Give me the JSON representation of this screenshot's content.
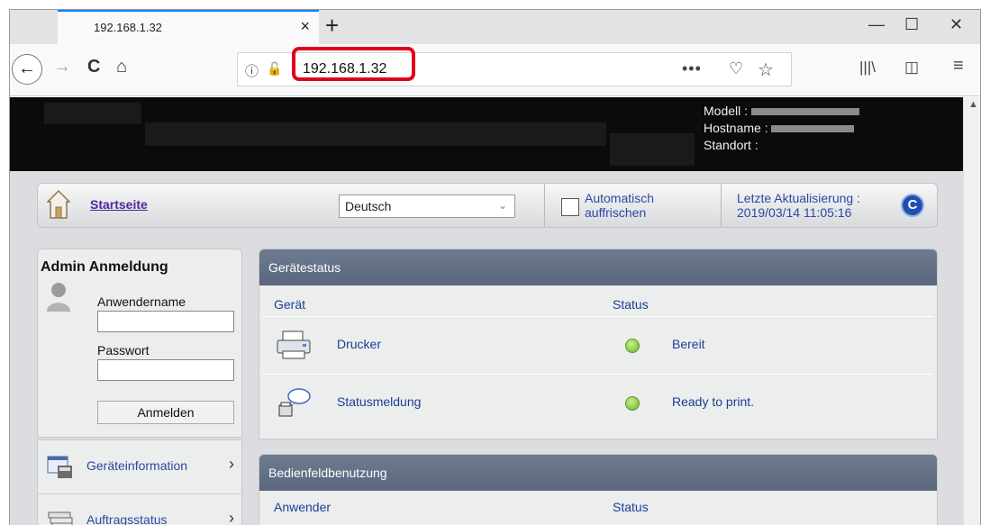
{
  "browser": {
    "tab_title": "192.168.1.32",
    "tab_close": "×",
    "new_tab": "+",
    "url": "192.168.1.32",
    "min": "—",
    "max": "☐",
    "close": "✕",
    "accent": "#0a84ff",
    "highlight_color": "#e0001a"
  },
  "header": {
    "model_label": "Modell :",
    "hostname_label": "Hostname :",
    "location_label": "Standort :"
  },
  "topbar": {
    "home_link": "Startseite",
    "language": "Deutsch",
    "auto_refresh_line1": "Automatisch",
    "auto_refresh_line2": "auffrischen",
    "last_update_label": "Letzte Aktualisierung :",
    "last_update_value": "2019/03/14 11:05:16",
    "refresh_glyph": "C"
  },
  "login": {
    "title": "Admin Anmeldung",
    "username_label": "Anwendername",
    "password_label": "Passwort",
    "login_button": "Anmelden"
  },
  "sidenav": {
    "items": [
      {
        "label": "Geräteinformation",
        "icon": "device-info-icon"
      },
      {
        "label": "Auftragsstatus",
        "icon": "job-status-icon"
      }
    ]
  },
  "device_status": {
    "title": "Gerätestatus",
    "col_device": "Gerät",
    "col_status": "Status",
    "rows": [
      {
        "name": "Drucker",
        "status": "Bereit",
        "icon": "printer-icon",
        "status_color": "#6cb02a"
      },
      {
        "name": "Statusmeldung",
        "status": "Ready to print.",
        "icon": "status-message-icon",
        "status_color": "#6cb02a"
      }
    ]
  },
  "panel_usage": {
    "title": "Bedienfeldbenutzung",
    "col_user": "Anwender",
    "col_status": "Status"
  }
}
